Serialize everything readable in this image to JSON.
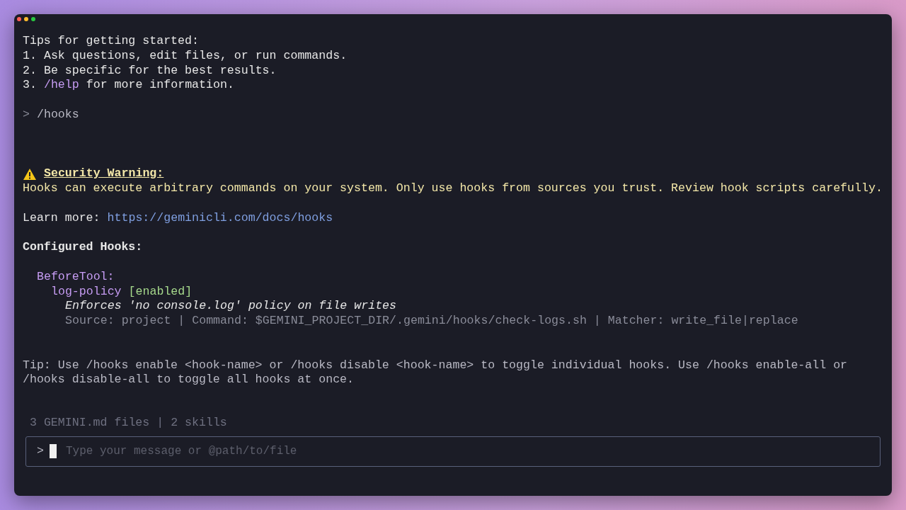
{
  "tips": {
    "heading": "Tips for getting started:",
    "items": [
      {
        "number": "1.",
        "parts": [
          {
            "text": "Ask questions, edit files, or run commands.",
            "kind": "plain"
          }
        ]
      },
      {
        "number": "2.",
        "parts": [
          {
            "text": "Be specific for the best results.",
            "kind": "plain"
          }
        ]
      },
      {
        "number": "3.",
        "parts": [
          {
            "text": "/help",
            "kind": "command"
          },
          {
            "text": "for more information.",
            "kind": "plain"
          }
        ]
      }
    ]
  },
  "user_command": {
    "prompt": ">",
    "text": "/hooks"
  },
  "warning": {
    "title": "Security Warning:",
    "body": "Hooks can execute arbitrary commands on your system. Only use hooks from sources you trust. Review hook scripts carefully."
  },
  "learn_more": {
    "label": "Learn more:",
    "link": "https://geminicli.com/docs/hooks"
  },
  "configured": {
    "heading": "Configured Hooks:",
    "events": [
      {
        "name": "BeforeTool:",
        "hooks": [
          {
            "name": "log-policy",
            "status": "[enabled]",
            "enabled": true,
            "description": "Enforces 'no console.log' policy on file writes",
            "details": "Source: project | Command: $GEMINI_PROJECT_DIR/.gemini/hooks/check-logs.sh | Matcher: write_file|replace"
          }
        ]
      }
    ]
  },
  "tip": "Tip: Use /hooks enable <hook-name> or /hooks disable <hook-name> to toggle individual hooks. Use /hooks enable-all or /hooks disable-all to toggle all hooks at once.",
  "footer": "3 GEMINI.md files | 2 skills",
  "input": {
    "prompt": ">",
    "placeholder": "Type your message or @path/to/file"
  }
}
